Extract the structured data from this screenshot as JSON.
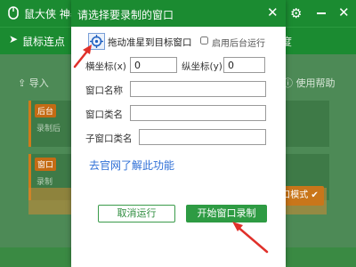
{
  "app": {
    "title": "鼠大侠 神器",
    "menu_item": "鼠标连点",
    "menu_right": "度",
    "toolbar_left": "导入",
    "toolbar_right": "使用帮助",
    "card1_tag": "后台",
    "card1_desc": "录制后",
    "card2_tag": "窗口",
    "card2_desc": "录制",
    "mode_button": "窗口模式"
  },
  "dialog": {
    "title": "请选择要录制的窗口",
    "drag_label": "拖动准星到目标窗口",
    "enable_background_label": "启用后台运行",
    "enable_background_checked": false,
    "x_label": "横坐标(x)",
    "x_value": "0",
    "y_label": "纵坐标(y)",
    "y_value": "0",
    "window_name_label": "窗口名称",
    "window_name_value": "",
    "window_class_label": "窗口类名",
    "window_class_value": "",
    "child_class_label": "子窗口类名",
    "child_class_value": "",
    "link_text": "去官网了解此功能",
    "cancel_label": "取消运行",
    "start_label": "开始窗口录制"
  },
  "colors": {
    "title_green": "#1b8b31",
    "button_green": "#2e9b43",
    "link_blue": "#2f6fd6",
    "arrow_red": "#e0302a"
  },
  "icons": {
    "crosshair": "crosshair-target-icon",
    "close": "close-icon",
    "settings": "gear-icon",
    "minimize": "minimize-icon"
  }
}
